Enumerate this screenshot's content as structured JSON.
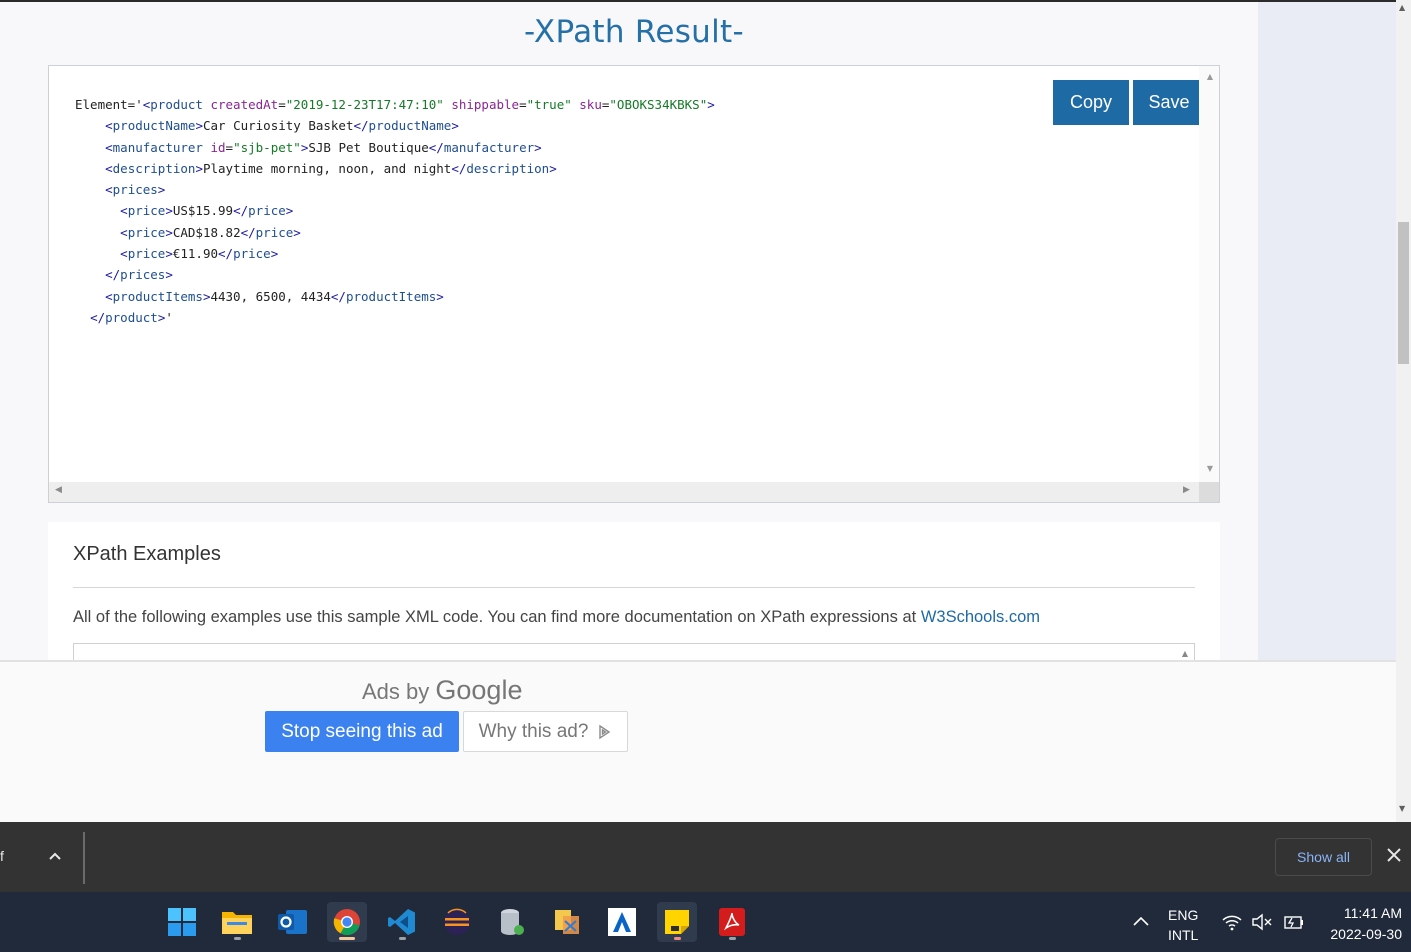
{
  "page": {
    "result_title": "-XPath Result-",
    "copy_label": "Copy",
    "save_label": "Save"
  },
  "code": {
    "l1_prefix": "Element='",
    "l1_open": "<",
    "l1_tag": "product",
    "attr1": " createdAt",
    "attr1_eq": "=",
    "val1": "\"2019-12-23T17:47:10\"",
    "attr2": " shippable",
    "attr2_eq": "=",
    "val2": "\"true\"",
    "attr3": " sku",
    "attr3_eq": "=",
    "val3": "\"OBOKS34KBKS\"",
    "l1_close": ">",
    "product_name": "Car Curiosity Basket",
    "manufacturer_id": "\"sjb-pet\"",
    "manufacturer": "SJB Pet Boutique",
    "description": "Playtime morning, noon, and night",
    "price1": "US$15.99",
    "price2": "CAD$18.82",
    "price3": "€11.90",
    "product_items": "4430, 6500, 4434",
    "end_suffix": "'"
  },
  "tags": {
    "productName": "productName",
    "manufacturer": "manufacturer",
    "id_attr": "id",
    "description": "description",
    "prices": "prices",
    "price": "price",
    "productItems": "productItems",
    "product": "product"
  },
  "examples": {
    "heading": "XPath Examples",
    "text": "All of the following examples use this sample XML code. You can find more documentation on XPath expressions at",
    "link": "W3Schools.com"
  },
  "ad": {
    "ads_by": "Ads by",
    "brand": "Google",
    "stop_label": "Stop seeing this ad",
    "why_label": "Why this ad?"
  },
  "download_bar": {
    "item_fragment": "f",
    "show_all": "Show all"
  },
  "taskbar": {
    "lang_top": "ENG",
    "lang_bottom": "INTL",
    "time": "11:41 AM",
    "date": "2022-09-30",
    "apps": [
      "start-icon",
      "file-explorer-icon",
      "outlook-icon",
      "chrome-icon",
      "vscode-icon",
      "eclipse-icon",
      "database-icon",
      "xml-tool-icon",
      "azure-icon",
      "sticky-notes-icon",
      "acrobat-icon"
    ]
  },
  "colors": {
    "accent": "#1e6aa5",
    "ad_button": "#3b82f0",
    "taskbar": "#202a3a",
    "download_bar": "#333333"
  }
}
